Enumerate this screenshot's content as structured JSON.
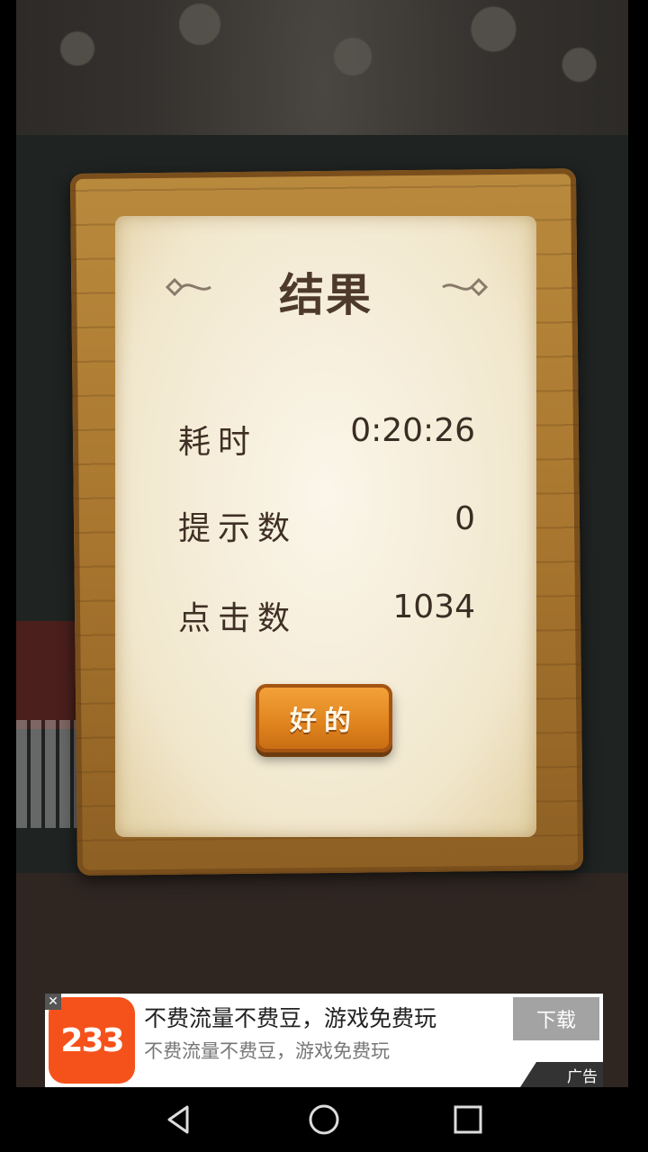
{
  "dialog": {
    "title": "结果",
    "rows": [
      {
        "label": "耗时",
        "value": "0:20:26"
      },
      {
        "label": "提示数",
        "value": "0"
      },
      {
        "label": "点击数",
        "value": "1034"
      }
    ],
    "ok_label": "好的"
  },
  "ad": {
    "logo_text": "233",
    "title": "不费流量不费豆，游戏免费玩",
    "subtitle": "不费流量不费豆，游戏免费玩",
    "download_label": "下载",
    "tag_label": "广告",
    "close_label": "✕"
  },
  "colors": {
    "button_orange": "#e2861f",
    "parchment": "#f1e7cd",
    "wood": "#a9772f",
    "ad_logo": "#f5521b"
  }
}
